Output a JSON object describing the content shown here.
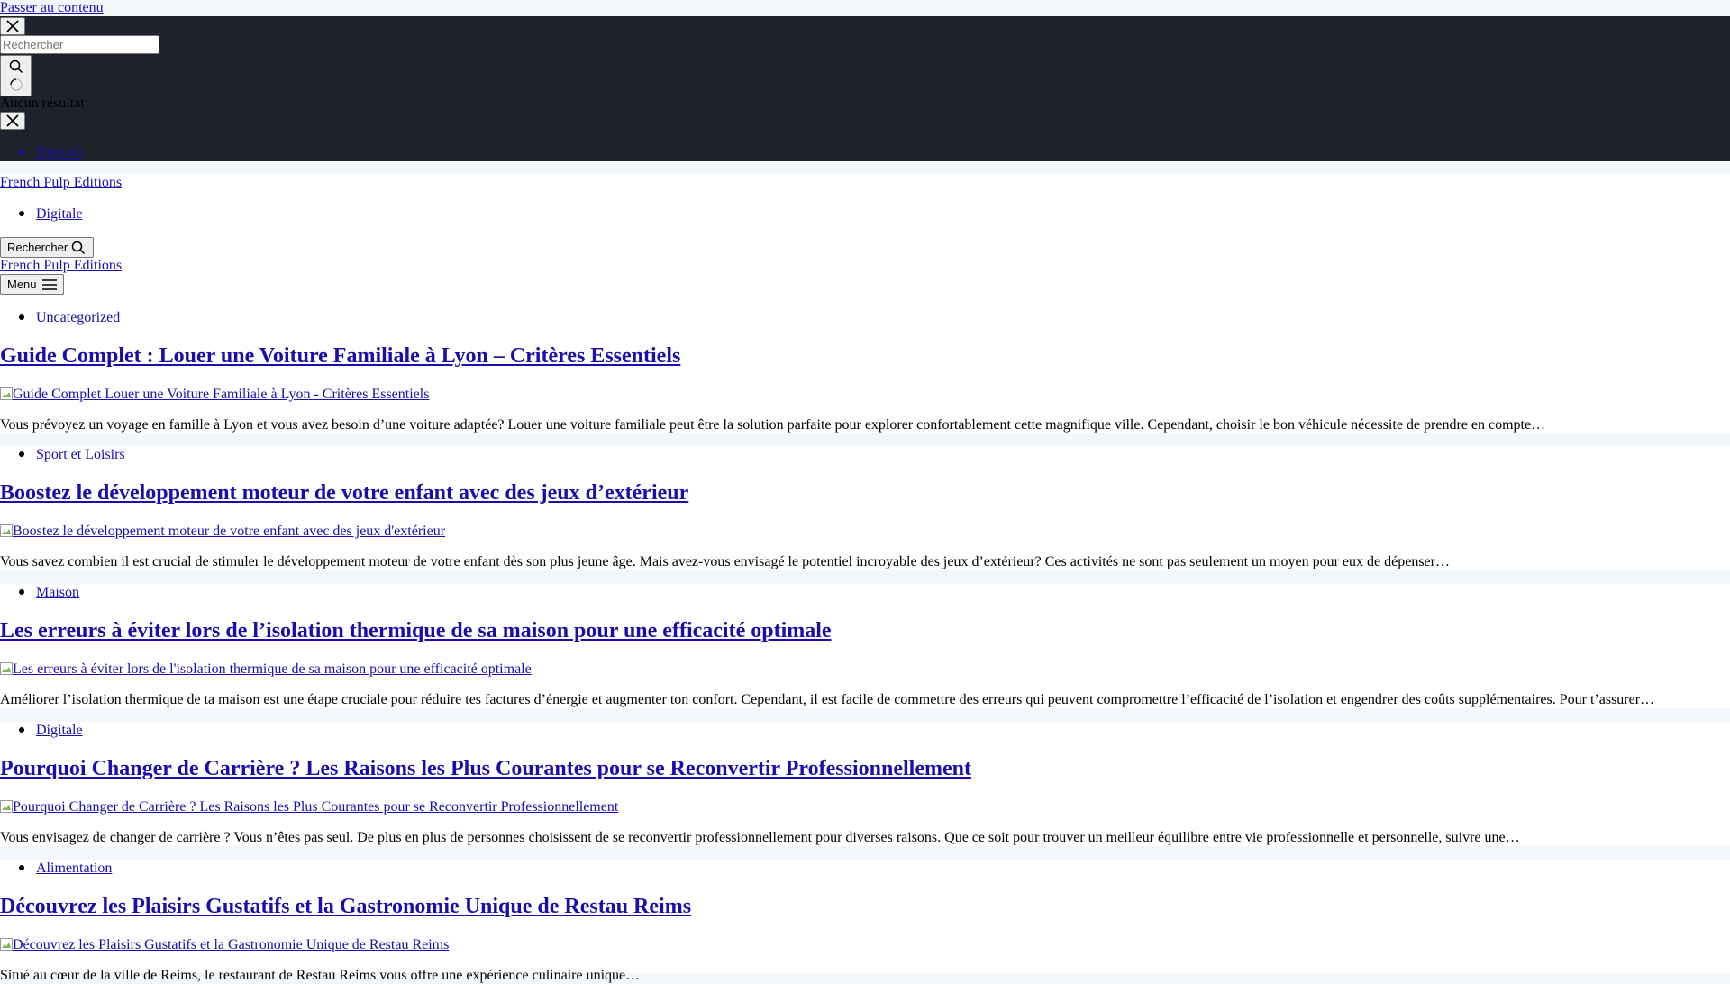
{
  "skip_link": "Passer au contenu",
  "search_modal": {
    "placeholder": "Rechercher",
    "no_results": "Aucun résultat"
  },
  "mobile_menu": {
    "items": [
      {
        "label": "Digitale"
      }
    ]
  },
  "header": {
    "site_title": "French Pulp Editions",
    "nav": [
      {
        "label": "Digitale"
      }
    ],
    "search_button_label": "Rechercher",
    "menu_button_label": "Menu"
  },
  "posts": [
    {
      "category": "Uncategorized",
      "title": "Guide Complet : Louer une Voiture Familiale à Lyon – Critères Essentiels",
      "image_alt": "Guide Complet Louer une Voiture Familiale à Lyon - Critères Essentiels",
      "excerpt": "Vous prévoyez un voyage en famille à Lyon et vous avez besoin d’une voiture adaptée? Louer une voiture familiale peut être la solution parfaite pour explorer confortablement cette magnifique ville. Cependant, choisir le bon véhicule nécessite de prendre en compte…"
    },
    {
      "category": "Sport et Loisirs",
      "title": "Boostez le développement moteur de votre enfant avec des jeux d’extérieur",
      "image_alt": "Boostez le développement moteur de votre enfant avec des jeux d'extérieur",
      "excerpt": "Vous savez combien il est crucial de stimuler le développement moteur de votre enfant dès son plus jeune âge. Mais avez-vous envisagé le potentiel incroyable des jeux d’extérieur? Ces activités ne sont pas seulement un moyen pour eux de dépenser…"
    },
    {
      "category": "Maison",
      "title": "Les erreurs à éviter lors de l’isolation thermique de sa maison pour une efficacité optimale",
      "image_alt": "Les erreurs à éviter lors de l'isolation thermique de sa maison pour une efficacité optimale",
      "excerpt": "Améliorer l’isolation thermique de ta maison est une étape cruciale pour réduire tes factures d’énergie et augmenter ton confort. Cependant, il est facile de commettre des erreurs qui peuvent compromettre l’efficacité de l’isolation et engendrer des coûts supplémentaires. Pour t’assurer…"
    },
    {
      "category": "Digitale",
      "title": "Pourquoi Changer de Carrière ? Les Raisons les Plus Courantes pour se Reconvertir Professionnellement",
      "image_alt": "Pourquoi Changer de Carrière ? Les Raisons les Plus Courantes pour se Reconvertir Professionnellement",
      "excerpt": "Vous envisagez de changer de carrière ? Vous n’êtes pas seul. De plus en plus de personnes choisissent de se reconvertir professionnellement pour diverses raisons. Que ce soit pour trouver un meilleur équilibre entre vie professionnelle et personnelle, suivre une…"
    },
    {
      "category": "Alimentation",
      "title": "Découvrez les Plaisirs Gustatifs et la Gastronomie Unique de Restau Reims",
      "image_alt": "Découvrez les Plaisirs Gustatifs et la Gastronomie Unique de Restau Reims",
      "excerpt": "Situé au cœur de la ville de Reims, le restaurant de Restau Reims vous offre une expérience culinaire unique…"
    }
  ]
}
